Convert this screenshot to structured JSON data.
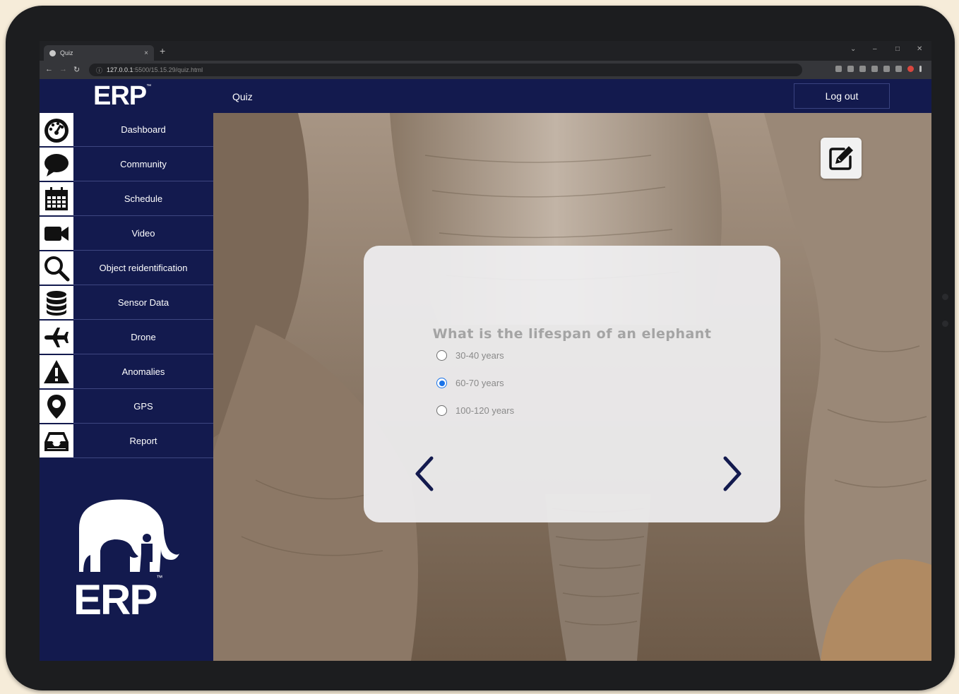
{
  "browser": {
    "tab_title": "Quiz",
    "tab_close": "×",
    "new_tab": "+",
    "url_host": "127.0.0.1",
    "url_rest": ":5500/15.15.29/quiz.html",
    "window_controls": [
      "⌄",
      "–",
      "□",
      "✕"
    ]
  },
  "header": {
    "logo_text": "ERP",
    "logo_tm": "™",
    "page_title": "Quiz",
    "logout_label": "Log out"
  },
  "sidebar": {
    "items": [
      {
        "label": "Dashboard",
        "icon": "dashboard-gauge-icon"
      },
      {
        "label": "Community",
        "icon": "speech-bubble-icon"
      },
      {
        "label": "Schedule",
        "icon": "calendar-icon"
      },
      {
        "label": "Video",
        "icon": "video-camera-icon"
      },
      {
        "label": "Object reidentification",
        "icon": "magnifier-icon"
      },
      {
        "label": "Sensor Data",
        "icon": "database-icon"
      },
      {
        "label": "Drone",
        "icon": "airplane-icon"
      },
      {
        "label": "Anomalies",
        "icon": "warning-triangle-icon"
      },
      {
        "label": "GPS",
        "icon": "map-pin-icon"
      },
      {
        "label": "Report",
        "icon": "inbox-tray-icon"
      }
    ],
    "logo_text": "ERP",
    "logo_tm": "™"
  },
  "quiz": {
    "question": "What is the lifespan of an elephant",
    "options": [
      {
        "label": "30-40 years",
        "selected": false
      },
      {
        "label": "60-70 years",
        "selected": true
      },
      {
        "label": "100-120 years",
        "selected": false
      }
    ],
    "prev_icon": "chevron-left-icon",
    "next_icon": "chevron-right-icon"
  },
  "colors": {
    "navy": "#131a4e",
    "radio_selected": "#1a73e8",
    "question_text": "#a4a4a4"
  }
}
